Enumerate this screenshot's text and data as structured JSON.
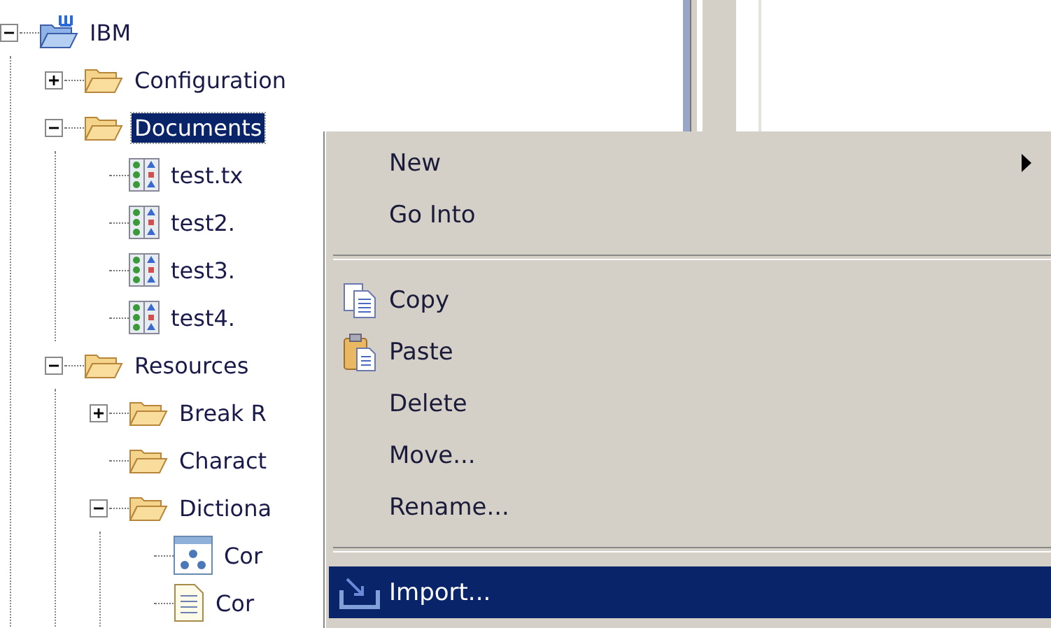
{
  "tree": [
    {
      "label": "IBM",
      "kind": "project",
      "expanded": true,
      "selected": false,
      "children": [
        {
          "label": "Configuration",
          "kind": "folder",
          "expanded": false,
          "selected": false
        },
        {
          "label": "Documents",
          "kind": "folder",
          "expanded": true,
          "selected": true,
          "children": [
            {
              "label": "test.tx",
              "kind": "grid-file",
              "selected": false
            },
            {
              "label": "test2.",
              "kind": "grid-file",
              "selected": false
            },
            {
              "label": "test3.",
              "kind": "grid-file",
              "selected": false
            },
            {
              "label": "test4.",
              "kind": "grid-file",
              "selected": false
            }
          ]
        },
        {
          "label": "Resources",
          "kind": "folder",
          "expanded": true,
          "selected": false,
          "children": [
            {
              "label": "Break R",
              "kind": "folder",
              "expanded": false,
              "selected": false
            },
            {
              "label": "Charact",
              "kind": "folder",
              "selected": false
            },
            {
              "label": "Dictiona",
              "kind": "folder",
              "expanded": true,
              "selected": false,
              "children": [
                {
                  "label": "Cor",
                  "kind": "diagram-file",
                  "selected": false
                },
                {
                  "label": "Cor",
                  "kind": "text-file",
                  "selected": false
                }
              ]
            }
          ]
        }
      ]
    }
  ],
  "context_menu": [
    {
      "kind": "item",
      "label": "New",
      "submenu": true,
      "selected": false
    },
    {
      "kind": "item",
      "label": "Go Into",
      "selected": false
    },
    {
      "kind": "separator"
    },
    {
      "kind": "item",
      "label": "Copy",
      "selected": false
    },
    {
      "kind": "item",
      "label": "Paste",
      "selected": false
    },
    {
      "kind": "item",
      "label": "Delete",
      "selected": false
    },
    {
      "kind": "item",
      "label": "Move...",
      "selected": false
    },
    {
      "kind": "item",
      "label": "Rename...",
      "selected": false
    },
    {
      "kind": "separator"
    },
    {
      "kind": "item",
      "label": "Import...",
      "selected": true
    }
  ]
}
